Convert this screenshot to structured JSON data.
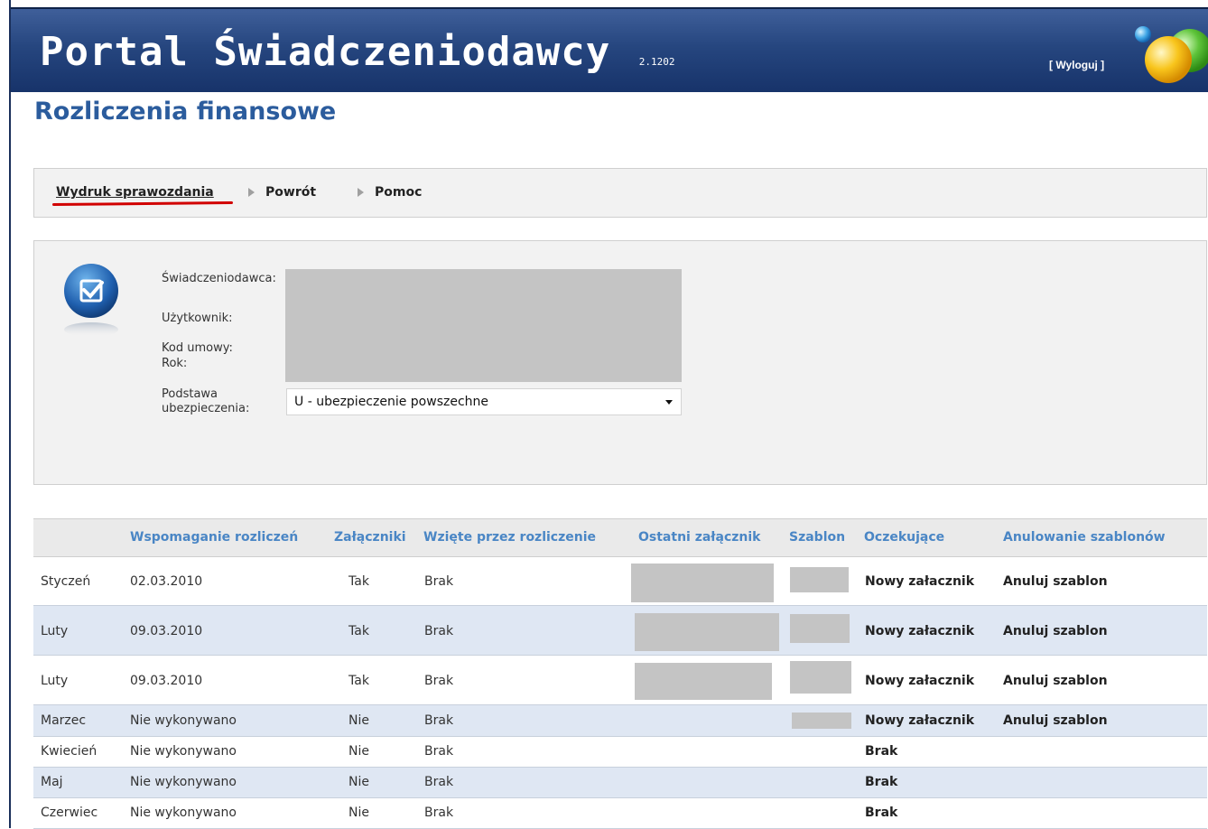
{
  "header": {
    "title": "Portal Świadczeniodawcy",
    "version": "2.1202",
    "logout_label": "[ Wyloguj ]"
  },
  "page_title": "Rozliczenia finansowe",
  "toolbar": {
    "print_label": "Wydruk sprawozdania",
    "back_label": "Powrót",
    "help_label": "Pomoc"
  },
  "info": {
    "provider_label": "Świadczeniodawca:",
    "user_label": "Użytkownik:",
    "contract_label": "Kod umowy:",
    "year_label": "Rok:",
    "insurance_label_line1": "Podstawa",
    "insurance_label_line2": "ubezpieczenia:",
    "insurance_value": "U - ubezpieczenie powszechne"
  },
  "table": {
    "columns": [
      "Wspomaganie rozliczeń",
      "Załączniki",
      "Wzięte przez rozliczenie",
      "Ostatni załącznik",
      "Szablon",
      "Oczekujące",
      "Anulowanie szablonów"
    ],
    "rows": [
      {
        "month": "Styczeń",
        "support": "02.03.2010",
        "attachments": "Tak",
        "taken": "Brak",
        "pending": "Nowy załacznik",
        "cancel": "Anuluj szablon"
      },
      {
        "month": "Luty",
        "support": "09.03.2010",
        "attachments": "Tak",
        "taken": "Brak",
        "pending": "Nowy załacznik",
        "cancel": "Anuluj szablon"
      },
      {
        "month": "Luty",
        "support": "09.03.2010",
        "attachments": "Tak",
        "taken": "Brak",
        "pending": "Nowy załacznik",
        "cancel": "Anuluj szablon"
      },
      {
        "month": "Marzec",
        "support": "Nie wykonywano",
        "attachments": "Nie",
        "taken": "Brak",
        "pending": "Nowy załacznik",
        "cancel": "Anuluj szablon"
      },
      {
        "month": "Kwiecień",
        "support": "Nie wykonywano",
        "attachments": "Nie",
        "taken": "Brak",
        "pending": "Brak",
        "cancel": ""
      },
      {
        "month": "Maj",
        "support": "Nie wykonywano",
        "attachments": "Nie",
        "taken": "Brak",
        "pending": "Brak",
        "cancel": ""
      },
      {
        "month": "Czerwiec",
        "support": "Nie wykonywano",
        "attachments": "Nie",
        "taken": "Brak",
        "pending": "Brak",
        "cancel": ""
      }
    ]
  },
  "colors": {
    "header_blue": "#26467f",
    "title_blue": "#2b5c9d",
    "column_header_blue": "#4a86c5",
    "alt_row": "#dfe7f3",
    "redaction_gray": "#c4c4c4",
    "underline_red": "#d10000"
  },
  "icons": {
    "info_icon": "checkbox-document-icon",
    "logo": "colored-spheres-logo"
  }
}
